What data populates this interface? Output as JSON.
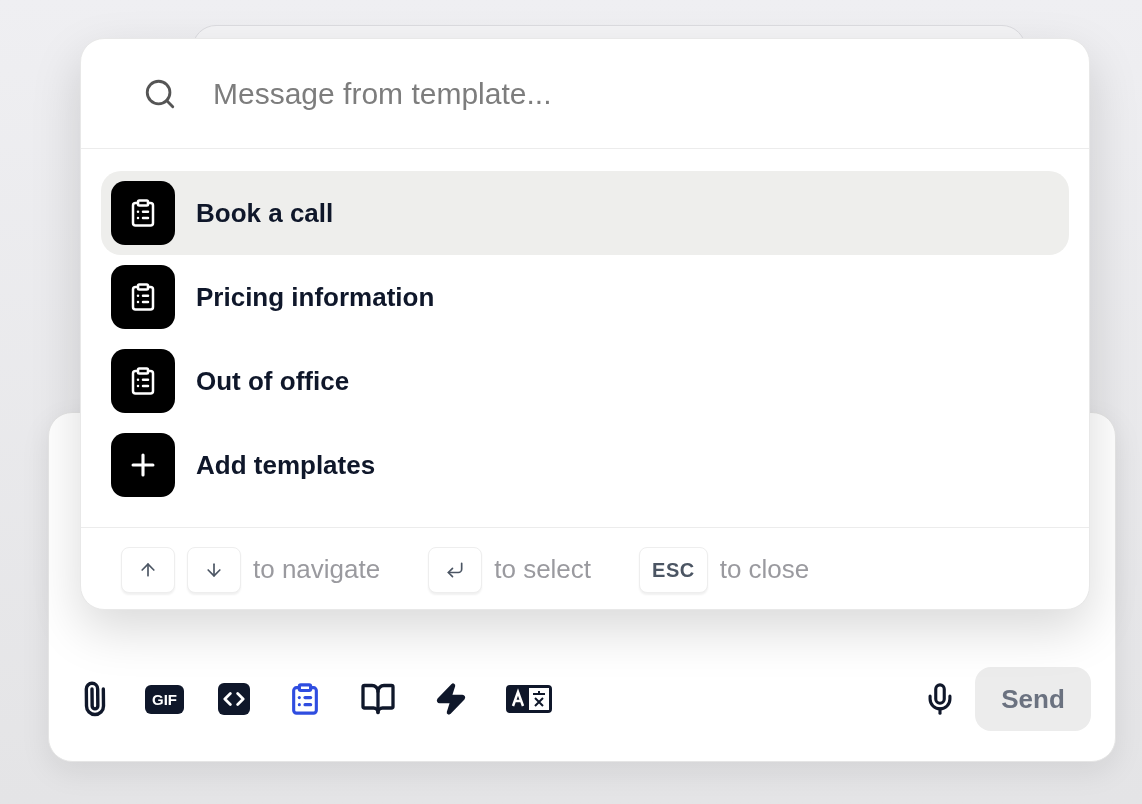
{
  "search": {
    "placeholder": "Message from template..."
  },
  "templates": [
    {
      "label": "Book a call",
      "kind": "template",
      "selected": true
    },
    {
      "label": "Pricing information",
      "kind": "template",
      "selected": false
    },
    {
      "label": "Out of office",
      "kind": "template",
      "selected": false
    },
    {
      "label": "Add templates",
      "kind": "add",
      "selected": false
    }
  ],
  "hints": [
    {
      "keys": [
        {
          "kind": "up"
        },
        {
          "kind": "down"
        }
      ],
      "text": "to navigate"
    },
    {
      "keys": [
        {
          "kind": "enter"
        }
      ],
      "text": "to select"
    },
    {
      "keys": [
        {
          "kind": "text",
          "label": "ESC"
        }
      ],
      "text": "to close"
    }
  ],
  "toolbar": [
    {
      "kind": "attach",
      "selected": false
    },
    {
      "kind": "gif",
      "label": "GIF",
      "selected": false
    },
    {
      "kind": "code",
      "selected": false
    },
    {
      "kind": "template",
      "selected": true
    },
    {
      "kind": "book",
      "selected": false
    },
    {
      "kind": "bolt",
      "selected": false
    },
    {
      "kind": "translate",
      "selected": false
    }
  ],
  "send_button": "Send"
}
